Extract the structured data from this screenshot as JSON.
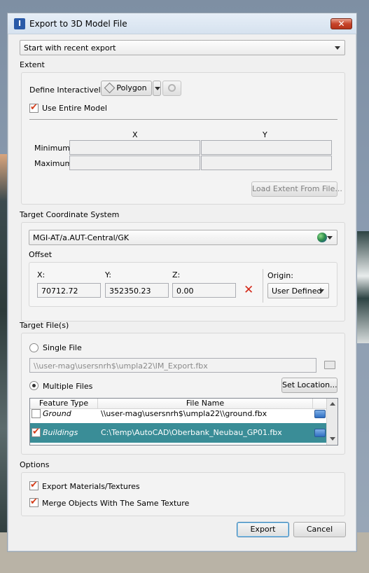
{
  "window": {
    "title": "Export to 3D Model File",
    "close_glyph": "✕"
  },
  "start": {
    "selected": "Start with recent export"
  },
  "extent": {
    "label": "Extent",
    "define_label": "Define Interactively:",
    "polygon_label": "Polygon",
    "use_entire_label": "Use Entire Model",
    "use_entire_checked": true,
    "col_x": "X",
    "col_y": "Y",
    "min_label": "Minimum:",
    "max_label": "Maximum:",
    "min_x": "",
    "min_y": "",
    "max_x": "",
    "max_y": "",
    "load_button": "Load Extent From File..."
  },
  "coord": {
    "label": "Target Coordinate System",
    "selected": "MGI-AT/a.AUT-Central/GK",
    "offset_label": "Offset",
    "x_label": "X:",
    "y_label": "Y:",
    "z_label": "Z:",
    "x_value": "70712.72",
    "y_value": "352350.23",
    "z_value": "0.00",
    "origin_label": "Origin:",
    "origin_selected": "User Defined"
  },
  "files": {
    "label": "Target File(s)",
    "single_label": "Single File",
    "single_path": "\\\\user-mag\\usersnrh$\\umpla22\\IM_Export.fbx",
    "multiple_label": "Multiple Files",
    "set_location": "Set Location...",
    "columns": [
      "Feature Type",
      "File Name"
    ],
    "rows": [
      {
        "type": "Ground",
        "file": "\\\\user-mag\\usersnrh$\\umpla22\\\\ground.fbx",
        "checked": false
      },
      {
        "type": "Buildings",
        "file": "C:\\Temp\\AutoCAD\\Oberbank_Neubau_GP01.fbx",
        "checked": true
      }
    ]
  },
  "options": {
    "label": "Options",
    "export_materials": "Export Materials/Textures",
    "merge_objects": "Merge Objects With The Same Texture"
  },
  "footer": {
    "export": "Export",
    "cancel": "Cancel"
  },
  "icons": {
    "app": "app-icon",
    "close": "close-icon",
    "polygon": "polygon-icon",
    "pick": "pick-icon",
    "globe": "globe-icon",
    "clear": "red-x-icon",
    "folder": "folder-icon",
    "open": "open-file-icon"
  }
}
